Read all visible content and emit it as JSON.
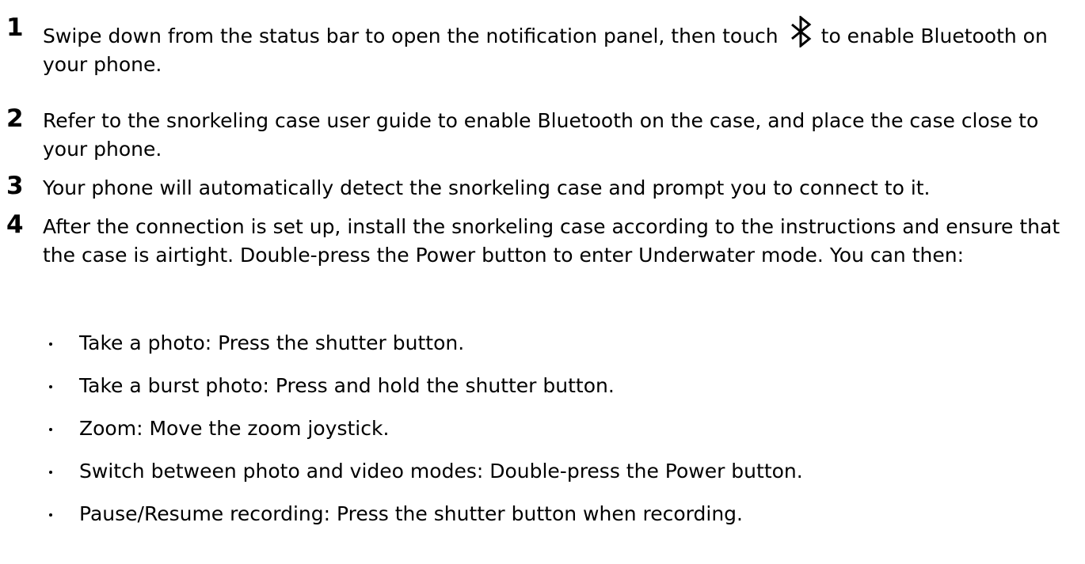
{
  "steps": [
    {
      "number": "1",
      "text_before_icon": "Swipe down from the status bar to open the notification panel, then touch",
      "icon": "bluetooth-icon",
      "text_after_icon": "to enable Bluetooth on your phone."
    },
    {
      "number": "2",
      "text": "Refer to the snorkeling case user guide to enable Bluetooth on the case, and place the case close to your phone."
    },
    {
      "number": "3",
      "text": "Your phone will automatically detect the snorkeling case and prompt you to connect to it."
    },
    {
      "number": "4",
      "text": "After the connection is set up, install the snorkeling case according to the instructions and ensure that the case is airtight. Double-press the Power button to enter Underwater mode. You can then:"
    }
  ],
  "bullets": [
    "Take a photo: Press the shutter button.",
    "Take a burst photo: Press and hold the shutter button.",
    "Zoom: Move the zoom joystick.",
    "Switch between photo and video modes: Double-press the Power button.",
    "Pause/Resume recording: Press the shutter button when recording."
  ]
}
